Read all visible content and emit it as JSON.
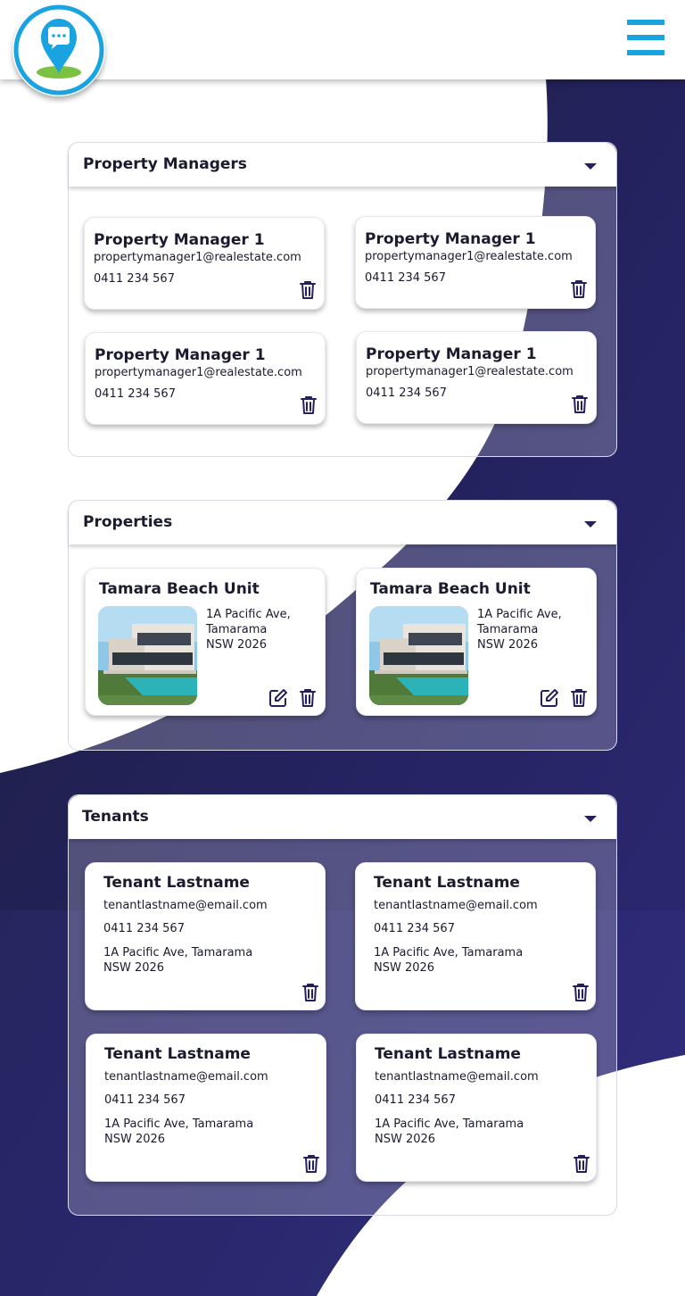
{
  "colors": {
    "accent": "#1aa3e1",
    "navy": "#24205c",
    "green": "#7bc142"
  },
  "header": {
    "logo_icon": "map-pin-chat-icon",
    "menu_icon": "hamburger-menu-icon"
  },
  "property_managers": {
    "title": "Property Managers",
    "items": [
      {
        "name": "Property Manager 1",
        "email": "propertymanager1@realestate.com",
        "phone": "0411 234 567"
      },
      {
        "name": "Property Manager 1",
        "email": "propertymanager1@realestate.com",
        "phone": "0411 234 567"
      },
      {
        "name": "Property Manager 1",
        "email": "propertymanager1@realestate.com",
        "phone": "0411 234 567"
      },
      {
        "name": "Property Manager 1",
        "email": "propertymanager1@realestate.com",
        "phone": "0411 234 567"
      }
    ]
  },
  "properties": {
    "title": "Properties",
    "items": [
      {
        "name": "Tamara Beach Unit",
        "address_line1": "1A Pacific Ave,",
        "address_line2": "Tamarama",
        "address_line3": "NSW 2026"
      },
      {
        "name": "Tamara Beach Unit",
        "address_line1": "1A Pacific Ave,",
        "address_line2": "Tamarama",
        "address_line3": "NSW 2026"
      }
    ]
  },
  "tenants": {
    "title": "Tenants",
    "items": [
      {
        "name": "Tenant Lastname",
        "email": "tenantlastname@email.com",
        "phone": "0411 234 567",
        "address_line1": "1A Pacific Ave, Tamarama",
        "address_line2": "NSW 2026"
      },
      {
        "name": "Tenant Lastname",
        "email": "tenantlastname@email.com",
        "phone": "0411 234 567",
        "address_line1": "1A Pacific Ave, Tamarama",
        "address_line2": "NSW 2026"
      },
      {
        "name": "Tenant Lastname",
        "email": "tenantlastname@email.com",
        "phone": "0411 234 567",
        "address_line1": "1A Pacific Ave, Tamarama",
        "address_line2": "NSW 2026"
      },
      {
        "name": "Tenant Lastname",
        "email": "tenantlastname@email.com",
        "phone": "0411 234 567",
        "address_line1": "1A Pacific Ave, Tamarama",
        "address_line2": "NSW 2026"
      }
    ]
  }
}
